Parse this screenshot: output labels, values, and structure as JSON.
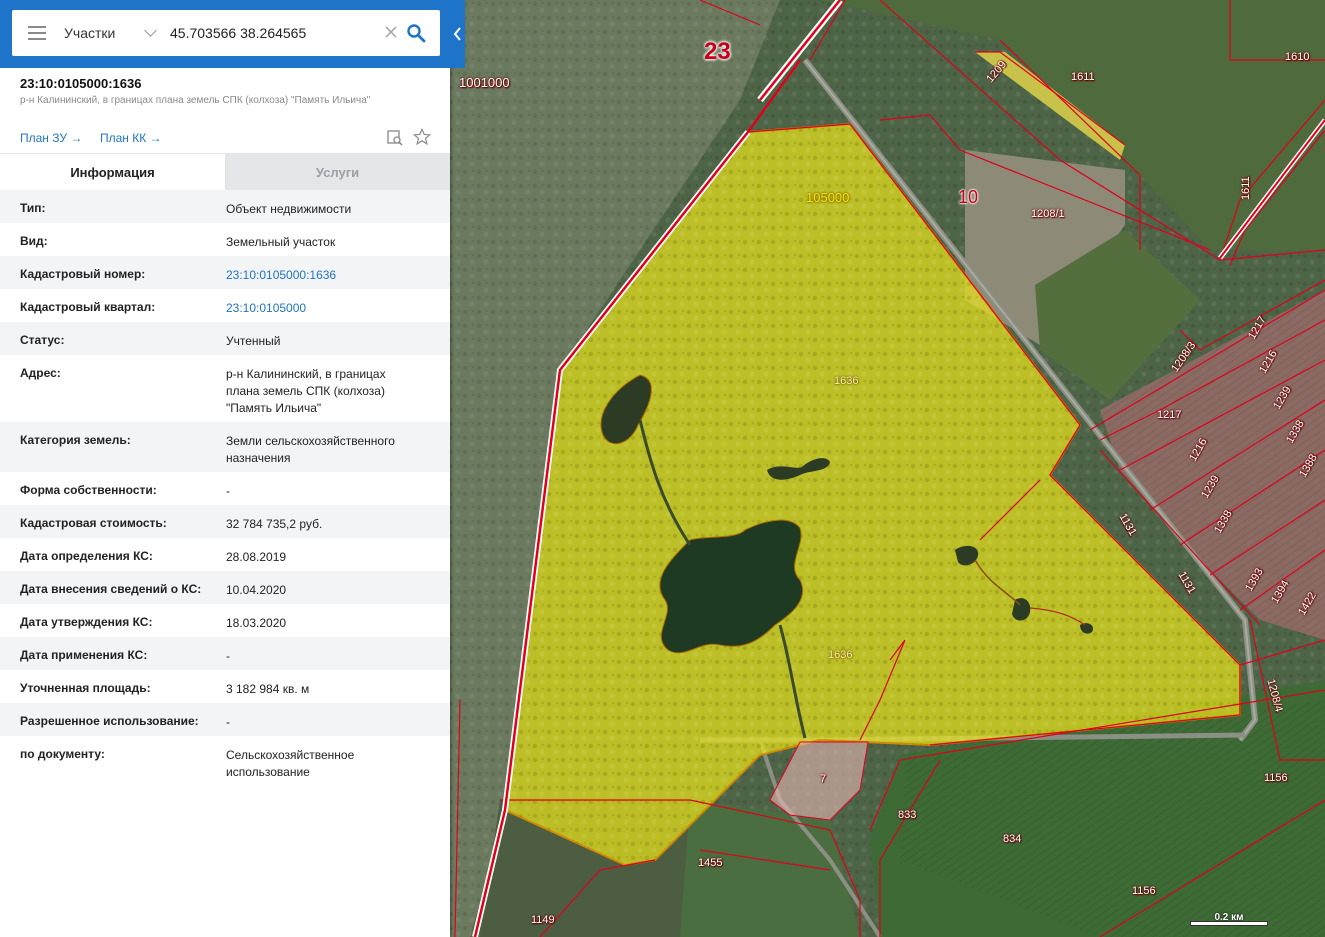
{
  "search": {
    "layer": "Участки",
    "query": "45.703566 38.264565"
  },
  "object": {
    "number": "23:10:0105000:1636",
    "address": "р-н Калининский, в границах плана земель СПК (колхоза) \"Память Ильича\""
  },
  "links": {
    "plan_zu": "План ЗУ →",
    "plan_kk": "План КК →"
  },
  "tabs": {
    "info": "Информация",
    "services": "Услуги"
  },
  "properties": [
    {
      "key": "Тип:",
      "value": "Объект недвижимости"
    },
    {
      "key": "Вид:",
      "value": "Земельный участок"
    },
    {
      "key": "Кадастровый номер:",
      "value": "23:10:0105000:1636"
    },
    {
      "key": "Кадастровый квартал:",
      "value": "23:10:0105000"
    },
    {
      "key": "Статус:",
      "value": "Учтенный"
    },
    {
      "key": "Адрес:",
      "value": "р-н Калининский, в границах плана земель СПК (колхоза) \"Память Ильича\""
    },
    {
      "key": "Категория земель:",
      "value": "Земли сельскохозяйственного назначения"
    },
    {
      "key": "Форма собственности:",
      "value": "-"
    },
    {
      "key": "Кадастровая стоимость:",
      "value": "32 784 735,2 руб."
    },
    {
      "key": "Дата определения КС:",
      "value": "28.08.2019"
    },
    {
      "key": "Дата внесения сведений о КС:",
      "value": "10.04.2020"
    },
    {
      "key": "Дата утверждения КС:",
      "value": "18.03.2020"
    },
    {
      "key": "Дата применения КС:",
      "value": "-"
    },
    {
      "key": "Уточненная площадь:",
      "value": "3 182 984 кв. м"
    },
    {
      "key": "Разрешенное использование:",
      "value": "-"
    },
    {
      "key": "по документу:",
      "value": "Сельскохозяйственное использование"
    }
  ],
  "map": {
    "labels": {
      "district_23": "23",
      "district_10": "10",
      "q_1001000": "1001000",
      "q_105000": "105000",
      "p_1636_a": "1636",
      "p_1636_b": "1636",
      "p_1209": "1209",
      "p_1611": "1611",
      "p_1610": "1610",
      "p_1611_v": "1611",
      "p_1208_1": "1208/1",
      "p_1208_3": "1208/3",
      "p_1217_a": "1217",
      "p_1216_a": "1216",
      "p_1239_a": "1239",
      "p_1338_a": "1338",
      "p_1388": "1388",
      "p_1217_b": "1217",
      "p_1216_b": "1216",
      "p_1239_b": "1239",
      "p_1338_b": "1338",
      "p_1393": "1393",
      "p_1394": "1394",
      "p_1422": "1422",
      "p_1131_a": "1131",
      "p_1131_b": "1131",
      "p_1208_4": "1208/4",
      "p_7": "7",
      "p_833": "833",
      "p_834": "834",
      "p_1156_a": "1156",
      "p_1156_b": "1156",
      "p_1455": "1455",
      "p_1149": "1149"
    },
    "scale": "0.2 км"
  },
  "colors": {
    "accent": "#1e74c8",
    "parcel_fill": "#e8e21a",
    "boundary": "#e0001b"
  }
}
